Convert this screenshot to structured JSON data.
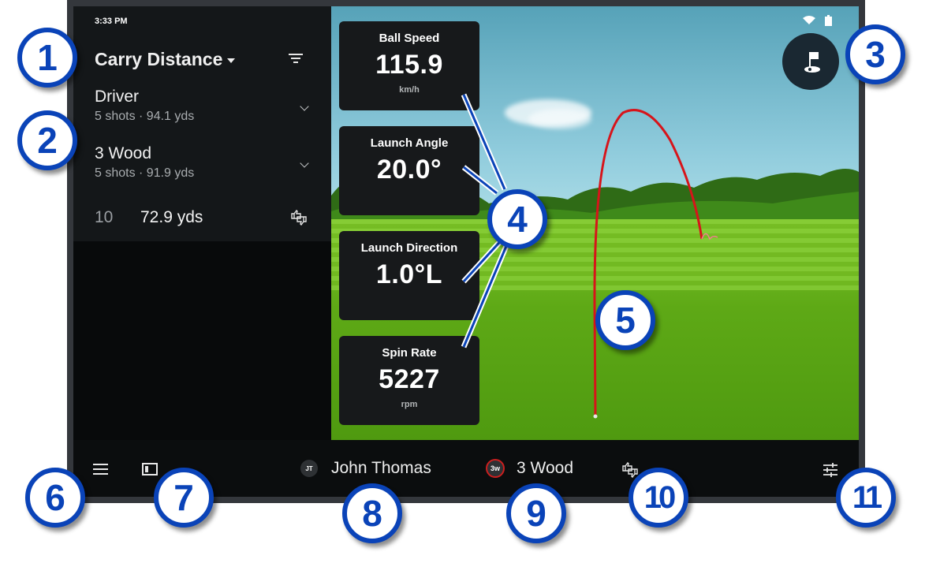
{
  "status_bar": {
    "time": "3:33 PM",
    "icons": [
      "wifi-icon",
      "battery-icon"
    ]
  },
  "sidebar": {
    "metric_selector": {
      "label": "Carry Distance",
      "icon": "caret-down-icon"
    },
    "filter_icon": "filter-icon",
    "clubs": [
      {
        "name": "Driver",
        "summary": "5 shots · 94.1 yds",
        "icon": "chevron-down-icon"
      },
      {
        "name": "3 Wood",
        "summary": "5 shots · 91.9 yds",
        "icon": "chevron-down-icon"
      }
    ],
    "shot": {
      "number": "10",
      "value": "72.9 yds",
      "icon": "thumbs-up-down-icon"
    }
  },
  "stats": [
    {
      "label": "Ball Speed",
      "value": "115.9",
      "unit": "km/h"
    },
    {
      "label": "Launch Angle",
      "value": "20.0°",
      "unit": ""
    },
    {
      "label": "Launch Direction",
      "value": "1.0°L",
      "unit": ""
    },
    {
      "label": "Spin Rate",
      "value": "5227",
      "unit": "rpm"
    }
  ],
  "scene": {
    "flag_button_icon": "golf-flag-icon",
    "trace_color": "#d7141a"
  },
  "bottom_bar": {
    "menu_icon": "hamburger-menu-icon",
    "panel_icon": "side-panel-toggle-icon",
    "user": {
      "initials": "JT",
      "name": "John Thomas"
    },
    "club": {
      "badge": "3w",
      "name": "3 Wood",
      "badge_color": "#cc1f1f"
    },
    "rate_icon": "thumbs-up-down-icon",
    "settings_icon": "sliders-icon"
  },
  "callouts": [
    "1",
    "2",
    "3",
    "4",
    "5",
    "6",
    "7",
    "8",
    "9",
    "10",
    "11"
  ],
  "colors": {
    "callout_blue": "#0a43b8",
    "panel_bg": "#141719",
    "card_bg": "#17191b"
  }
}
